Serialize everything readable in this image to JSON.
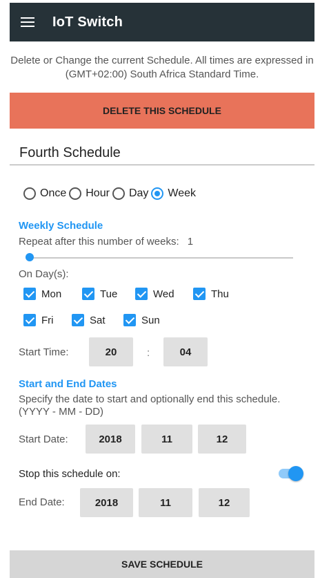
{
  "app": {
    "title": "IoT Switch",
    "menu_icon": "hamburger-menu-icon"
  },
  "info_text": "Delete or Change the current Schedule. All times are expressed in (GMT+02:00) South Africa Standard Time.",
  "delete_button": "DELETE THIS SCHEDULE",
  "schedule_name": "Fourth Schedule",
  "frequency": {
    "options": [
      "Once",
      "Hour",
      "Day",
      "Week"
    ],
    "selected": "Week"
  },
  "weekly": {
    "heading": "Weekly Schedule",
    "repeat_label": "Repeat after this number of weeks:",
    "repeat_value": "1",
    "days_label": "On Day(s):",
    "days": [
      {
        "label": "Mon",
        "checked": true
      },
      {
        "label": "Tue",
        "checked": true
      },
      {
        "label": "Wed",
        "checked": true
      },
      {
        "label": "Thu",
        "checked": true
      },
      {
        "label": "Fri",
        "checked": true
      },
      {
        "label": "Sat",
        "checked": true
      },
      {
        "label": "Sun",
        "checked": true
      }
    ],
    "start_time_label": "Start Time:",
    "hour": "20",
    "separator": ":",
    "minute": "04"
  },
  "dates": {
    "heading": "Start and End Dates",
    "description": "Specify the date to start and optionally end this schedule. (YYYY - MM - DD)",
    "start_label": "Start Date:",
    "start": {
      "year": "2018",
      "month": "11",
      "day": "12"
    },
    "stop_label": "Stop this schedule on:",
    "stop_enabled": true,
    "end_label": "End Date:",
    "end": {
      "year": "2018",
      "month": "11",
      "day": "12"
    }
  },
  "save_button": "SAVE SCHEDULE",
  "colors": {
    "appbar": "#263238",
    "delete": "#e8735a",
    "accent": "#2196f3",
    "save": "#d6d6d6"
  }
}
